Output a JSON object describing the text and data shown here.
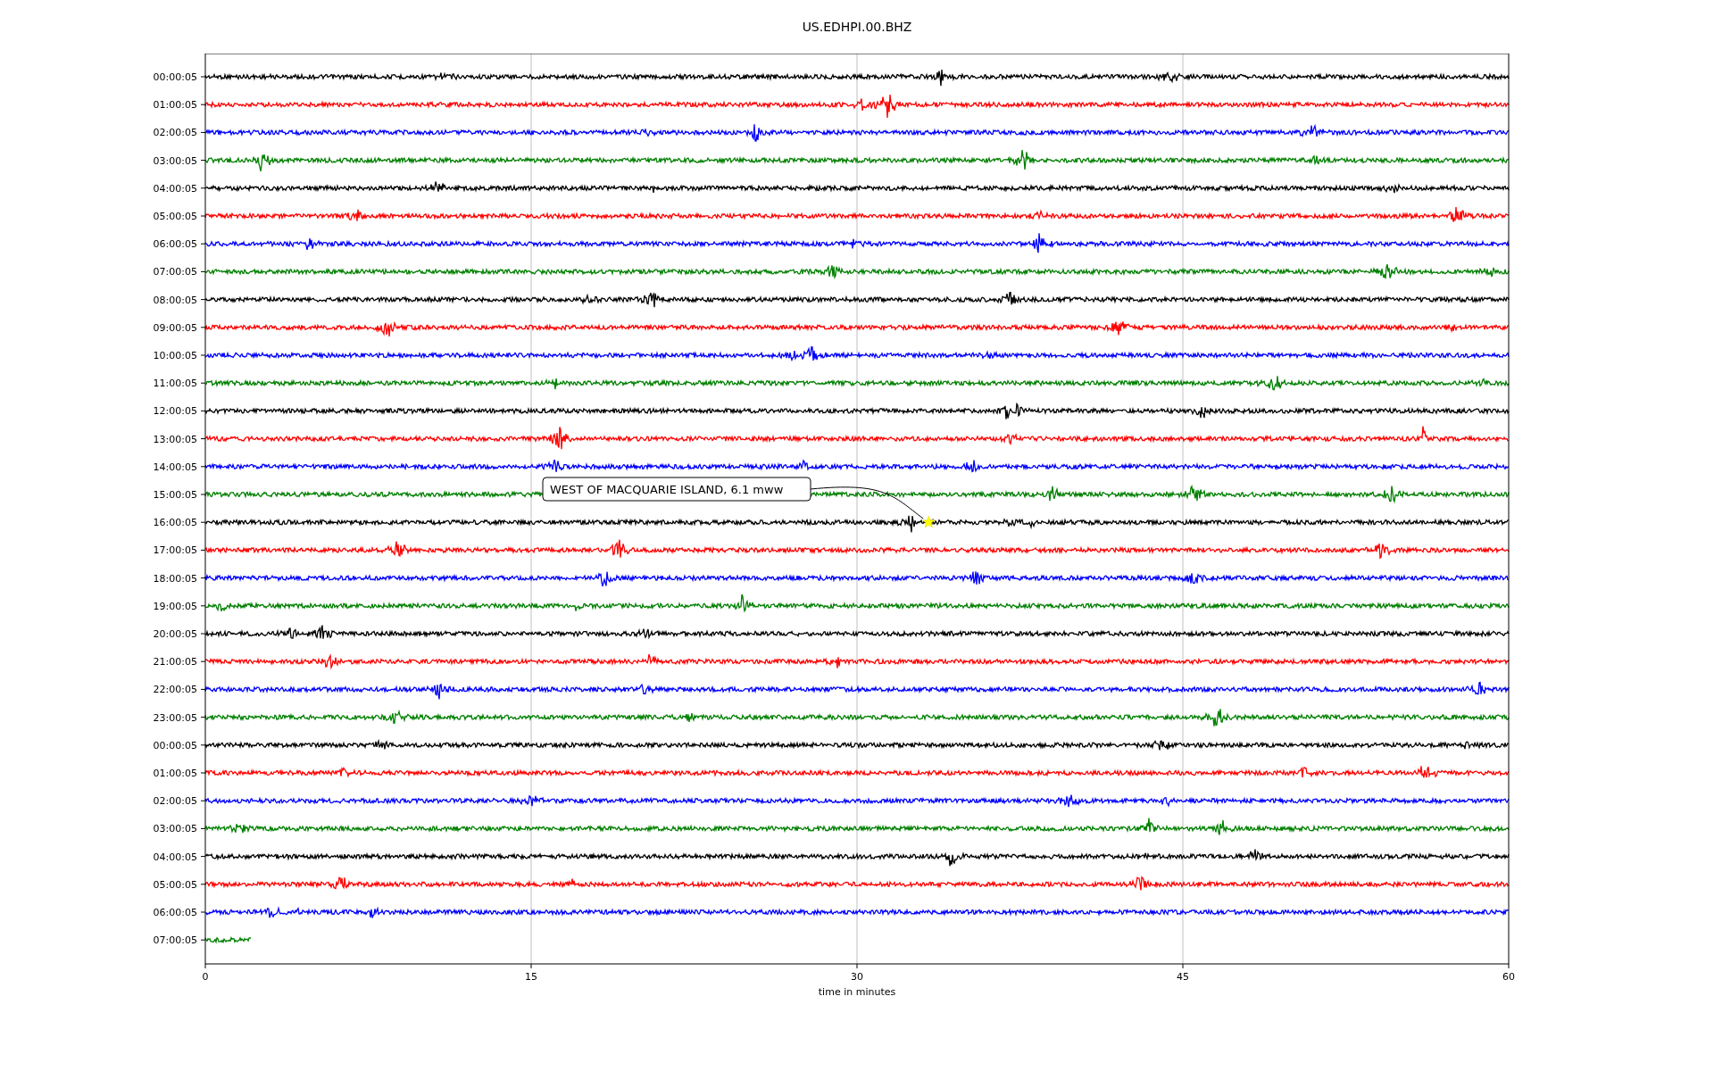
{
  "title": "US.EDHPI.00.BHZ",
  "rows": [
    {
      "label": "00:00:05",
      "color": "#000000",
      "complete": true
    },
    {
      "label": "01:00:05",
      "color": "#ff0000",
      "complete": true
    },
    {
      "label": "02:00:05",
      "color": "#0000ff",
      "complete": true
    },
    {
      "label": "03:00:05",
      "color": "#008000",
      "complete": true
    },
    {
      "label": "04:00:05",
      "color": "#000000",
      "complete": true
    },
    {
      "label": "05:00:05",
      "color": "#ff0000",
      "complete": true
    },
    {
      "label": "06:00:05",
      "color": "#0000ff",
      "complete": true
    },
    {
      "label": "07:00:05",
      "color": "#008000",
      "complete": true
    },
    {
      "label": "08:00:05",
      "color": "#000000",
      "complete": true
    },
    {
      "label": "09:00:05",
      "color": "#ff0000",
      "complete": true
    },
    {
      "label": "10:00:05",
      "color": "#0000ff",
      "complete": true
    },
    {
      "label": "11:00:05",
      "color": "#008000",
      "complete": true
    },
    {
      "label": "12:00:05",
      "color": "#000000",
      "complete": true
    },
    {
      "label": "13:00:05",
      "color": "#ff0000",
      "complete": true
    },
    {
      "label": "14:00:05",
      "color": "#0000ff",
      "complete": true
    },
    {
      "label": "15:00:05",
      "color": "#008000",
      "complete": true
    },
    {
      "label": "16:00:05",
      "color": "#000000",
      "complete": true
    },
    {
      "label": "17:00:05",
      "color": "#ff0000",
      "complete": true
    },
    {
      "label": "18:00:05",
      "color": "#0000ff",
      "complete": true
    },
    {
      "label": "19:00:05",
      "color": "#008000",
      "complete": true
    },
    {
      "label": "20:00:05",
      "color": "#000000",
      "complete": true
    },
    {
      "label": "21:00:05",
      "color": "#ff0000",
      "complete": true
    },
    {
      "label": "22:00:05",
      "color": "#0000ff",
      "complete": true
    },
    {
      "label": "23:00:05",
      "color": "#008000",
      "complete": true
    },
    {
      "label": "00:00:05",
      "color": "#000000",
      "complete": true
    },
    {
      "label": "01:00:05",
      "color": "#ff0000",
      "complete": true
    },
    {
      "label": "02:00:05",
      "color": "#0000ff",
      "complete": true
    },
    {
      "label": "03:00:05",
      "color": "#008000",
      "complete": true
    },
    {
      "label": "04:00:05",
      "color": "#000000",
      "complete": true
    },
    {
      "label": "05:00:05",
      "color": "#ff0000",
      "complete": true
    },
    {
      "label": "06:00:05",
      "color": "#0000ff",
      "complete": true
    },
    {
      "label": "07:00:05",
      "color": "#008000",
      "complete": false
    }
  ],
  "xticks": [
    "0",
    "15",
    "30",
    "45",
    "60"
  ],
  "xlabel": "time in minutes",
  "annotation": {
    "text": "WEST OF MACQUARIE ISLAND, 6.1 mww"
  }
}
